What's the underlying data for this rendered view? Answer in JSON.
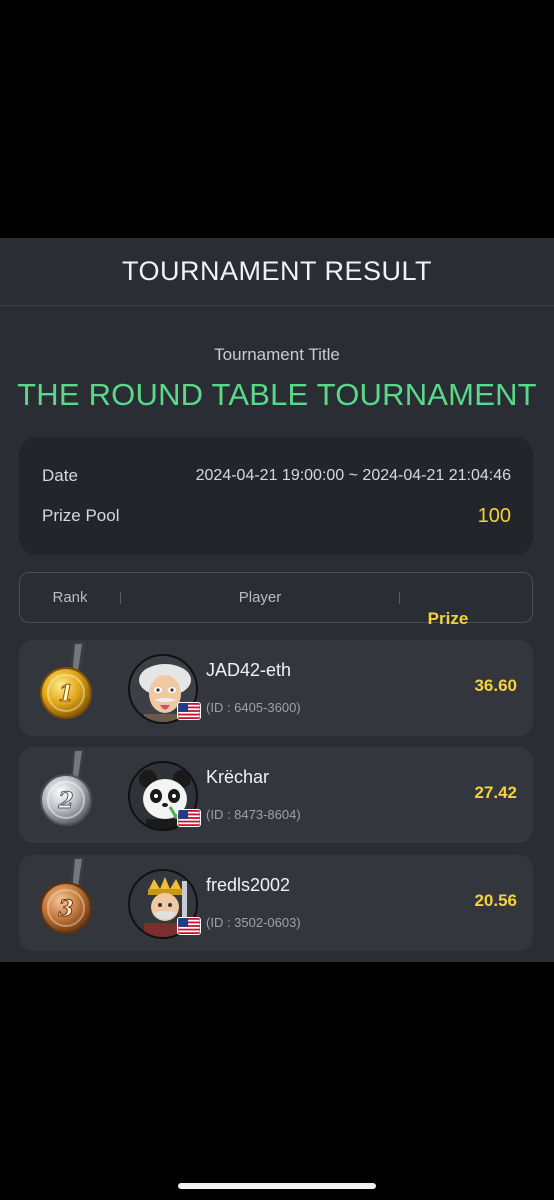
{
  "header": {
    "title": "TOURNAMENT RESULT"
  },
  "tournament": {
    "label": "Tournament Title",
    "name": "THE ROUND TABLE TOURNAMENT"
  },
  "info": {
    "date_label": "Date",
    "date_value": "2024-04-21 19:00:00 ~ 2024-04-21 21:04:46",
    "pool_label": "Prize Pool",
    "pool_value": "100"
  },
  "table": {
    "columns": [
      "Rank",
      "Player",
      "Prize"
    ],
    "rows": [
      {
        "rank": 1,
        "medal": "gold-medal-icon",
        "avatar": "einstein-avatar",
        "flag": "us-flag-icon",
        "name": "JAD42-eth",
        "id": "(ID : 6405-3600)",
        "prize": "36.60"
      },
      {
        "rank": 2,
        "medal": "silver-medal-icon",
        "avatar": "panda-avatar",
        "flag": "us-flag-icon",
        "name": "Krëchar",
        "id": "(ID : 8473-8604)",
        "prize": "27.42"
      },
      {
        "rank": 3,
        "medal": "bronze-medal-icon",
        "avatar": "king-avatar",
        "flag": "us-flag-icon",
        "name": "fredls2002",
        "id": "(ID : 3502-0603)",
        "prize": "20.56"
      }
    ]
  },
  "colors": {
    "accent_green": "#59d98a",
    "prize_yellow": "#f3d23a",
    "panel_bg": "#2a2d33"
  }
}
